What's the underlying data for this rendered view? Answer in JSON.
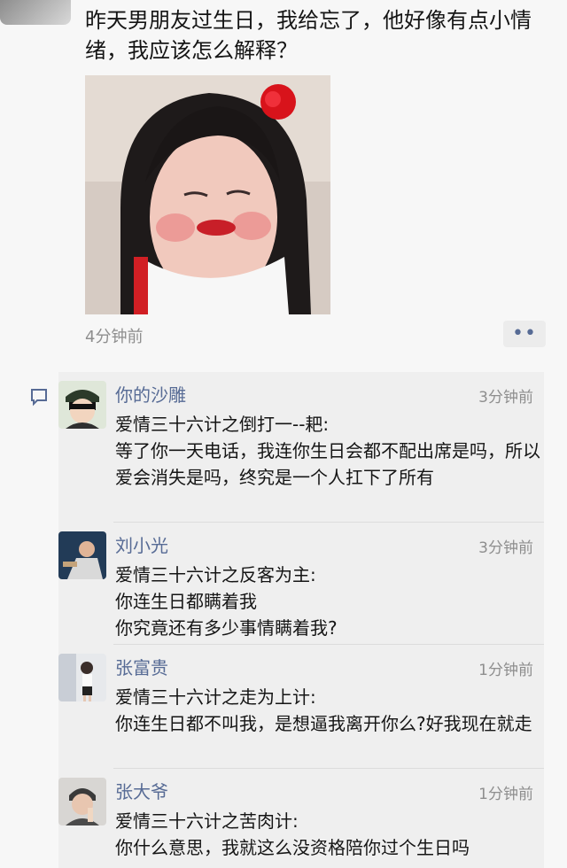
{
  "post": {
    "text": "昨天男朋友过生日，我给忘了，他好像有点小情绪，我应该怎么解释？",
    "time": "4分钟前",
    "more_icon": "more-dots-icon"
  },
  "comments": [
    {
      "name": "你的沙雕",
      "time": "3分钟前",
      "text": "爱情三十六计之倒打一--耙:\n等了你一天电话，我连你生日会都不配出席是吗，所以爱会消失是吗，终究是一个人扛下了所有"
    },
    {
      "name": "刘小光",
      "time": "3分钟前",
      "text": "爱情三十六计之反客为主:\n你连生日都瞒着我\n你究竟还有多少事情瞒着我?"
    },
    {
      "name": "张富贵",
      "time": "1分钟前",
      "text": "爱情三十六计之走为上计:\n你连生日都不叫我，是想逼我离开你么?好我现在就走"
    },
    {
      "name": "张大爷",
      "time": "1分钟前",
      "text": "爱情三十六计之苦肉计:\n你什么意思，我就这么没资格陪你过个生日吗"
    }
  ],
  "colors": {
    "name_link": "#576b95",
    "time_gray": "#8e8e8e",
    "comment_bg": "#efefef"
  }
}
